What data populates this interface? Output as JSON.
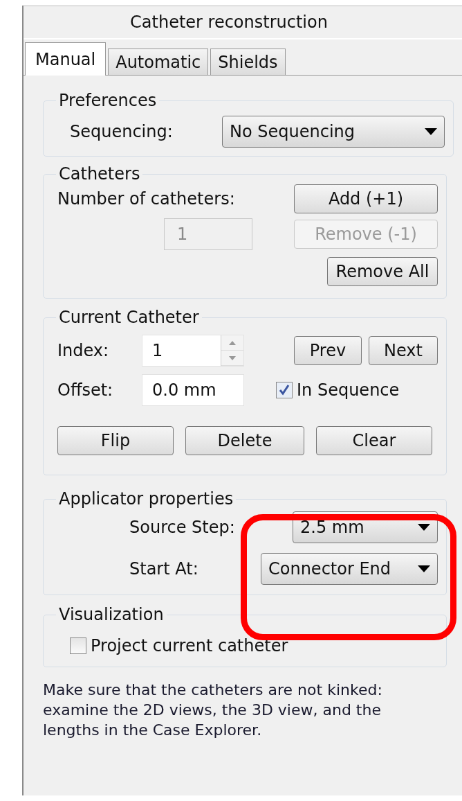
{
  "window": {
    "title": "Catheter reconstruction"
  },
  "tabs": [
    {
      "label": "Manual",
      "selected": true
    },
    {
      "label": "Automatic",
      "selected": false
    },
    {
      "label": "Shields",
      "selected": false
    }
  ],
  "preferences": {
    "title": "Preferences",
    "sequencing": {
      "label": "Sequencing:",
      "value": "No Sequencing"
    }
  },
  "catheters": {
    "title": "Catheters",
    "count_label": "Number of catheters:",
    "count": {
      "value": "1",
      "disabled": true
    },
    "buttons": [
      {
        "label": "Add (+1)",
        "disabled": false
      },
      {
        "label": "Remove (-1)",
        "disabled": true
      },
      {
        "label": "Remove All",
        "disabled": false
      }
    ]
  },
  "current_catheter": {
    "title": "Current Catheter",
    "index": {
      "label": "Index:",
      "value": "1"
    },
    "offset": {
      "label": "Offset:",
      "value": "0.0 mm"
    },
    "nav_buttons": [
      "Prev",
      "Next"
    ],
    "in_sequence": {
      "label": "In Sequence",
      "checked": true
    },
    "actions": [
      "Flip",
      "Delete",
      "Clear"
    ]
  },
  "applicator_properties": {
    "title": "Applicator properties",
    "source_step": {
      "label": "Source Step:",
      "value": "2.5 mm"
    },
    "start_at": {
      "label": "Start At:",
      "value": "Connector End"
    }
  },
  "visualization": {
    "title": "Visualization",
    "project_current": {
      "label": "Project current catheter",
      "checked": false
    }
  },
  "help_text": "Make sure that the catheters are not kinked:\nexamine the 2D views, the 3D view, and the\nlengths in the Case Explorer.",
  "annotation": {
    "kind": "highlight",
    "color": "#ff0000"
  }
}
